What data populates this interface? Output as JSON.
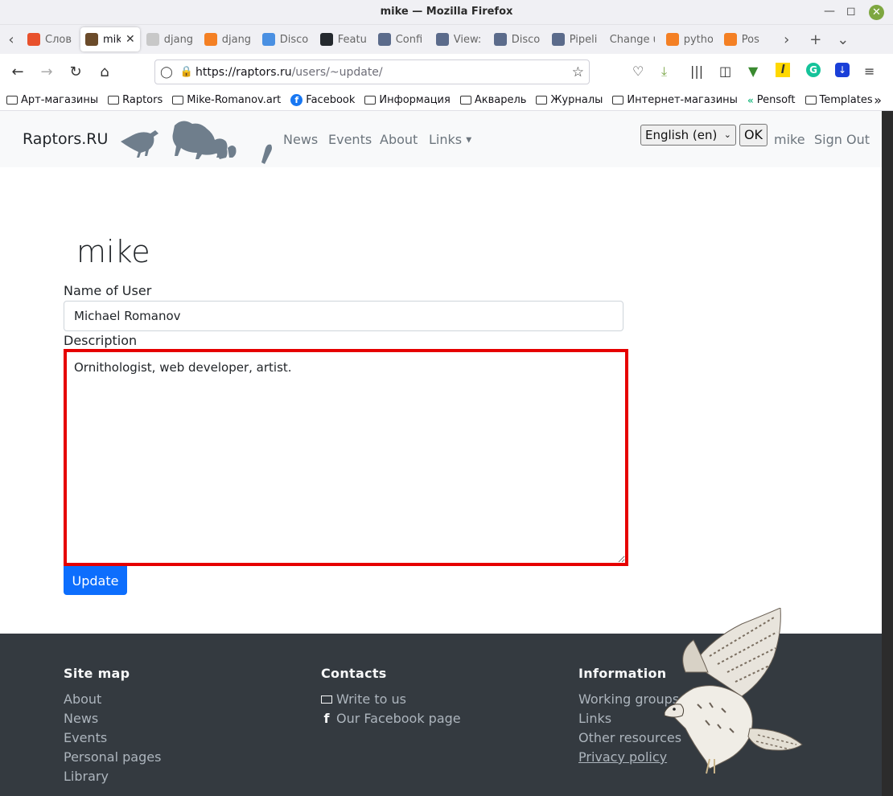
{
  "window": {
    "title": "mike — Mozilla Firefox"
  },
  "tabs": [
    {
      "label": "Слов",
      "icon": "p-favicon",
      "color": "#e8512c"
    },
    {
      "label": "mike",
      "icon": "owl-favicon",
      "color": "#6b4b2a",
      "active": true
    },
    {
      "label": "djang",
      "icon": "box-favicon",
      "color": "#c8c8c8"
    },
    {
      "label": "djang",
      "icon": "stackoverflow-favicon",
      "color": "#f48024"
    },
    {
      "label": "Disco",
      "icon": "django-favicon",
      "color": "#4a90e2"
    },
    {
      "label": "Featu",
      "icon": "github-favicon",
      "color": "#24292e"
    },
    {
      "label": "Confi",
      "icon": "doc-favicon",
      "color": "#5b6b8b"
    },
    {
      "label": "View:",
      "icon": "doc-favicon",
      "color": "#5b6b8b"
    },
    {
      "label": "Disco",
      "icon": "doc-favicon",
      "color": "#5b6b8b"
    },
    {
      "label": "Pipeli",
      "icon": "doc-favicon",
      "color": "#5b6b8b"
    },
    {
      "label": "Change u",
      "icon": "none",
      "color": "#ffffff"
    },
    {
      "label": "pytho",
      "icon": "stackoverflow-favicon",
      "color": "#f48024"
    },
    {
      "label": "Pos",
      "icon": "stackoverflow-favicon",
      "color": "#f48024"
    }
  ],
  "url": {
    "host": "https://raptors.ru",
    "path": "/users/~update/"
  },
  "bookmarks": [
    {
      "label": "Арт-магазины",
      "icon": "folder-icon"
    },
    {
      "label": "Raptors",
      "icon": "folder-icon"
    },
    {
      "label": "Mike-Romanov.art",
      "icon": "folder-icon"
    },
    {
      "label": "Facebook",
      "icon": "facebook-icon"
    },
    {
      "label": "Информация",
      "icon": "folder-icon"
    },
    {
      "label": "Акварель",
      "icon": "folder-icon"
    },
    {
      "label": "Журналы",
      "icon": "folder-icon"
    },
    {
      "label": "Интернет-магазины",
      "icon": "folder-icon"
    },
    {
      "label": "Pensoft",
      "icon": "pensoft-icon"
    },
    {
      "label": "Templates",
      "icon": "folder-icon"
    }
  ],
  "site": {
    "brand": "Raptors.RU",
    "nav": {
      "news": "News",
      "events": "Events",
      "about": "About",
      "links": "Links"
    },
    "lang": "English (en)",
    "ok": "OK",
    "user": "mike",
    "signout": "Sign Out"
  },
  "form": {
    "username": "mike",
    "name_label": "Name of User",
    "name_value": "Michael Romanov",
    "desc_label": "Description",
    "desc_value": "Ornithologist, web developer, artist.",
    "submit": "Update"
  },
  "footer": {
    "sitemap": {
      "heading": "Site map",
      "about": "About",
      "news": "News",
      "events": "Events",
      "personal": "Personal pages",
      "library": "Library"
    },
    "contacts": {
      "heading": "Contacts",
      "write": "Write to us",
      "facebook": "Our Facebook page"
    },
    "information": {
      "heading": "Information",
      "groups": "Working groups",
      "links": "Links",
      "other": "Other resources",
      "privacy": "Privacy policy"
    }
  }
}
